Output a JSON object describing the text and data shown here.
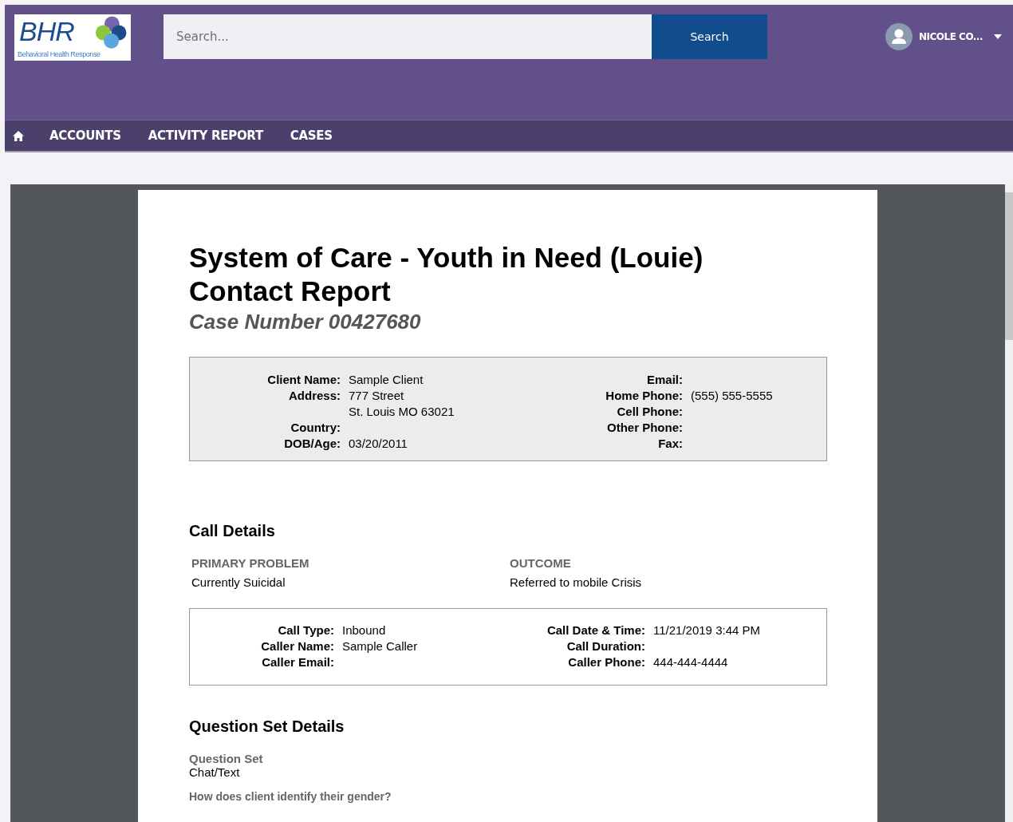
{
  "header": {
    "logo": {
      "text": "BHR",
      "tagline": "Behavioral Health Response"
    },
    "search": {
      "placeholder": "Search...",
      "button": "Search"
    },
    "user": {
      "name": "NICOLE CO..."
    }
  },
  "nav": {
    "items": [
      {
        "label": "ACCOUNTS"
      },
      {
        "label": "ACTIVITY REPORT"
      },
      {
        "label": "CASES"
      }
    ]
  },
  "report": {
    "title_lines": [
      "System of Care - Youth in Need (Louie)",
      "Contact Report"
    ],
    "case_number": "Case Number 00427680",
    "client": {
      "left": [
        {
          "label": "Client Name:",
          "lines": [
            "Sample Client"
          ]
        },
        {
          "label": "Address:",
          "lines": [
            "777 Street",
            "St. Louis MO 63021"
          ]
        },
        {
          "label": "Country:"
        },
        {
          "label": "DOB/Age:",
          "lines": [
            "03/20/2011"
          ]
        }
      ],
      "right": [
        {
          "label": "Email:"
        },
        {
          "label": "Home Phone:",
          "lines": [
            "(555) 555-5555"
          ]
        },
        {
          "label": "Cell Phone:"
        },
        {
          "label": "Other Phone:"
        },
        {
          "label": "Fax:"
        }
      ]
    },
    "call_details": {
      "heading": "Call Details",
      "summary": [
        {
          "label": "PRIMARY PROBLEM",
          "value": "Currently Suicidal"
        },
        {
          "label": "OUTCOME",
          "value": "Referred to mobile Crisis"
        }
      ],
      "left": [
        {
          "label": "Call Type:",
          "lines": [
            "Inbound"
          ]
        },
        {
          "label": "Caller Name:",
          "lines": [
            "Sample Caller"
          ]
        },
        {
          "label": "Caller Email:"
        }
      ],
      "right": [
        {
          "label": "Call Date & Time:",
          "lines": [
            "11/21/2019 3:44 PM"
          ]
        },
        {
          "label": "Call Duration:"
        },
        {
          "label": "Caller Phone:",
          "lines": [
            "444-444-4444"
          ]
        }
      ]
    },
    "question_set": {
      "heading": "Question Set Details",
      "label": "Question Set",
      "value": "Chat/Text",
      "next_question": "How does client identify their gender?"
    }
  }
}
